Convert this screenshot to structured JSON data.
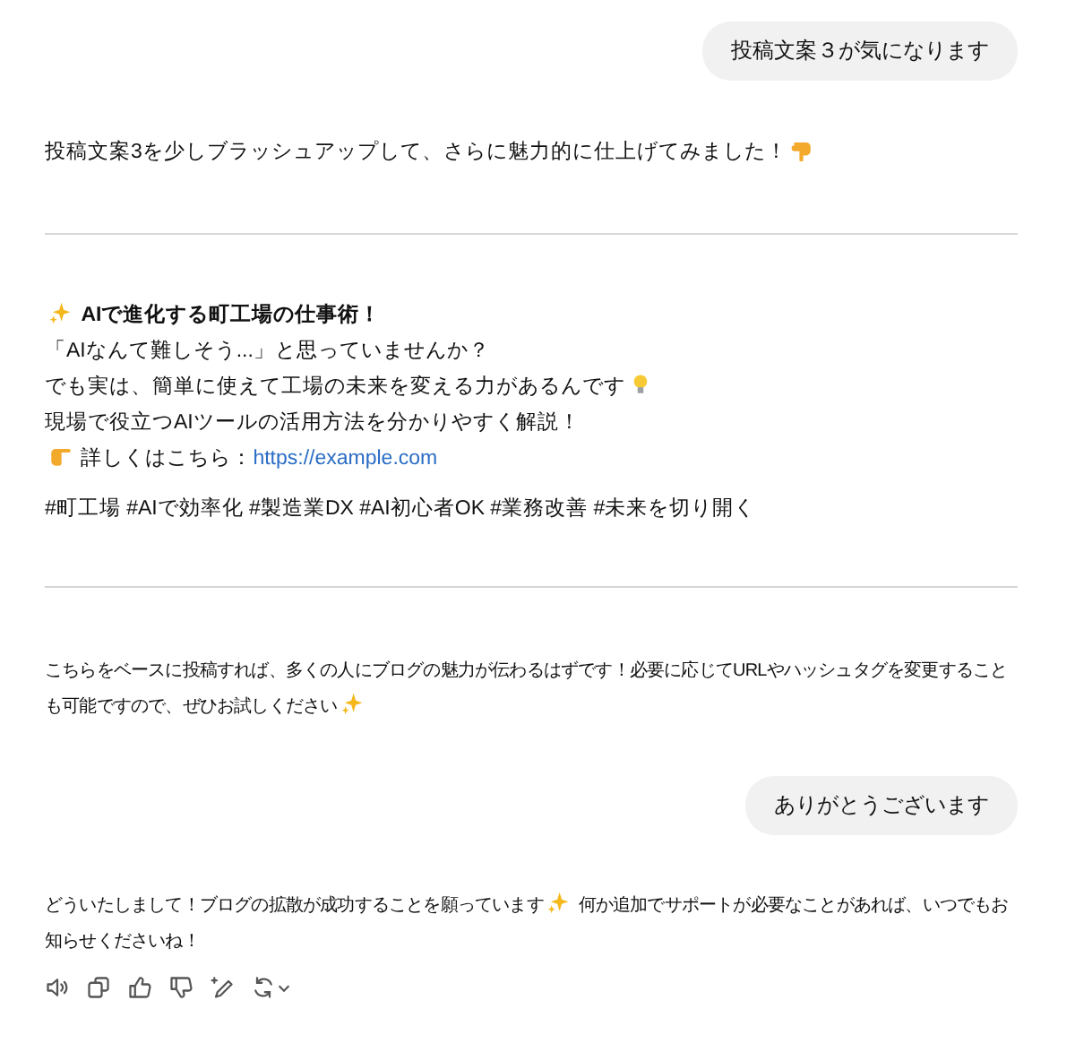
{
  "user_message_1": "投稿文案３が気になります",
  "intro": "投稿文案3を少しブラッシュアップして、さらに魅力的に仕上げてみました！",
  "post": {
    "title": "AIで進化する町工場の仕事術！",
    "lines": [
      "「AIなんて難しそう...」と思っていませんか？",
      "でも実は、簡単に使えて工場の未来を変える力があるんです",
      "現場で役立つAIツールの活用方法を分かりやすく解説！"
    ],
    "link_prefix": "詳しくはこちら：",
    "link": "https://example.com",
    "hashtags": "#町工場 #AIで効率化 #製造業DX #AI初心者OK #業務改善 #未来を切り開く"
  },
  "closing": [
    "こちらをベースに投稿すれば、多くの人にブログの魅力が伝わるはずです！必要に応じてURLやハッシュタグを変更すること",
    "も可能ですので、ぜひお試しください"
  ],
  "user_message_2": "ありがとうございます",
  "reply": [
    "どういたしまして！ブログの拡散が成功することを願っています",
    "何か追加でサポートが必要なことがあれば、いつでもお",
    "知らせくださいね！"
  ]
}
